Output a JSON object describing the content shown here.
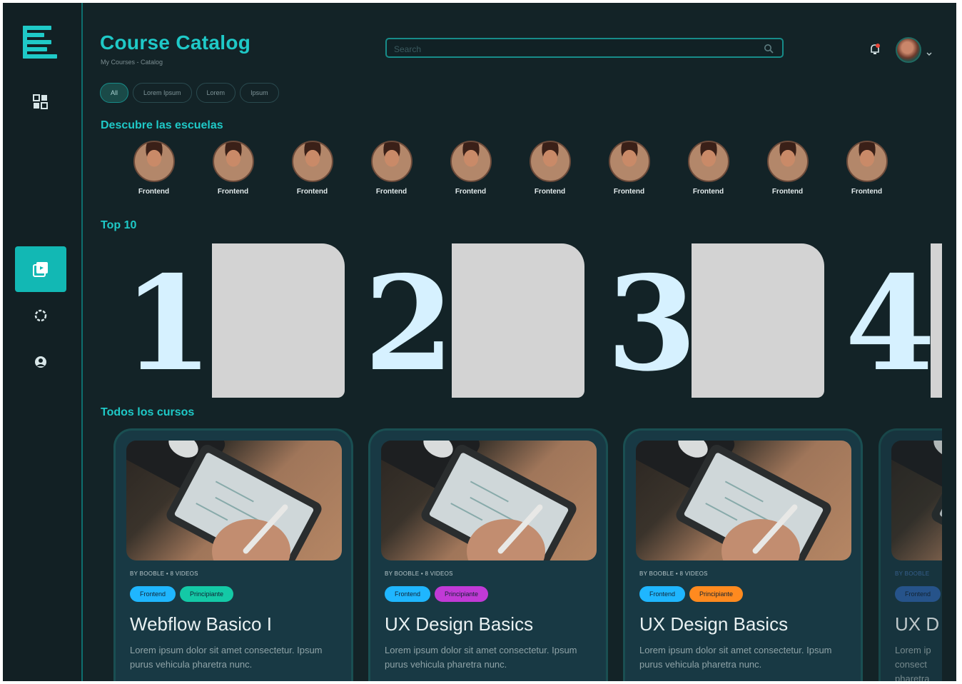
{
  "header": {
    "title": "Course Catalog",
    "breadcrumb": "My Courses - Catalog",
    "search_placeholder": "Search"
  },
  "filters": [
    "All",
    "Lorem Ipsum",
    "Lorem",
    "Ipsum"
  ],
  "schools_section": {
    "title": "Descubre las escuelas",
    "items": [
      "Frontend",
      "Frontend",
      "Frontend",
      "Frontend",
      "Frontend",
      "Frontend",
      "Frontend",
      "Frontend",
      "Frontend",
      "Frontend"
    ]
  },
  "top10": {
    "title": "Top 10",
    "ranks": [
      "1",
      "2",
      "3",
      "4"
    ]
  },
  "courses_section": {
    "title": "Todos los cursos",
    "courses": [
      {
        "meta": "BY BOOBLE  •  8 VIDEOS",
        "tags": [
          {
            "label": "Frontend",
            "color": "#1fb6ff"
          },
          {
            "label": "Principiante",
            "color": "#14c9a6"
          }
        ],
        "title": "Webflow Basico I",
        "description": "Lorem ipsum dolor sit amet consectetur. Ipsum purus vehicula pharetra nunc."
      },
      {
        "meta": "BY BOOBLE  •  8 VIDEOS",
        "tags": [
          {
            "label": "Frontend",
            "color": "#1fb6ff"
          },
          {
            "label": "Principiante",
            "color": "#c13ad6"
          }
        ],
        "title": "UX Design Basics",
        "description": "Lorem ipsum dolor sit amet consectetur. Ipsum purus vehicula pharetra nunc."
      },
      {
        "meta": "BY BOOBLE  •  8 VIDEOS",
        "tags": [
          {
            "label": "Frontend",
            "color": "#1fb6ff"
          },
          {
            "label": "Principiante",
            "color": "#ff8a1f"
          }
        ],
        "title": "UX Design Basics",
        "description": "Lorem ipsum dolor sit amet consectetur. Ipsum purus vehicula pharetra nunc."
      },
      {
        "meta": "BY BOOBLE",
        "tags": [
          {
            "label": "Frontend",
            "color": "#2b5fa3"
          }
        ],
        "title": "UX D",
        "description": "Lorem ip consect pharetra"
      }
    ]
  },
  "colors": {
    "accent": "#1fc9c7",
    "background": "#132327",
    "card": "#183944",
    "rank_text": "#d6f1ff"
  },
  "icons": [
    "logo-icon",
    "dashboard-icon",
    "catalog-icon",
    "settings-icon",
    "profile-icon",
    "search-icon",
    "notification-icon",
    "chevron-down-icon"
  ]
}
